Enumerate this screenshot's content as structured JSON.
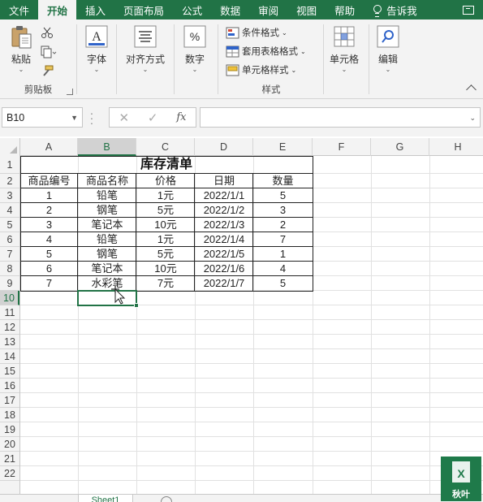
{
  "ribbon_tabs": [
    {
      "label": "文件"
    },
    {
      "label": "开始"
    },
    {
      "label": "插入"
    },
    {
      "label": "页面布局"
    },
    {
      "label": "公式"
    },
    {
      "label": "数据"
    },
    {
      "label": "审阅"
    },
    {
      "label": "视图"
    },
    {
      "label": "帮助"
    },
    {
      "label": "告诉我"
    }
  ],
  "active_tab": "开始",
  "clipboard": {
    "paste_label": "粘贴",
    "group_label": "剪贴板"
  },
  "font": {
    "label": "字体"
  },
  "alignment": {
    "label": "对齐方式"
  },
  "number": {
    "label": "数字"
  },
  "styles": {
    "conditional_format": "条件格式",
    "table_format": "套用表格格式",
    "cell_styles": "单元格样式",
    "group_label": "样式"
  },
  "cells_group": {
    "label": "单元格"
  },
  "editing": {
    "label": "编辑"
  },
  "formula_bar": {
    "name_box": "B10",
    "cancel": "✕",
    "enter": "✓",
    "fx": "fx",
    "formula": ""
  },
  "columns": [
    "A",
    "B",
    "C",
    "D",
    "E",
    "F",
    "G",
    "H"
  ],
  "selected_column": "B",
  "rows": [
    "1",
    "2",
    "3",
    "4",
    "5",
    "6",
    "7",
    "8",
    "9",
    "10",
    "11",
    "12",
    "13",
    "14",
    "15",
    "16",
    "17",
    "18",
    "19",
    "20",
    "21",
    "22"
  ],
  "selected_row": "10",
  "sheet": {
    "title": "库存清单",
    "headers": [
      "商品编号",
      "商品名称",
      "价格",
      "日期",
      "数量"
    ],
    "records": [
      [
        "1",
        "铅笔",
        "1元",
        "2022/1/1",
        "5"
      ],
      [
        "2",
        "钢笔",
        "5元",
        "2022/1/2",
        "3"
      ],
      [
        "3",
        "笔记本",
        "10元",
        "2022/1/3",
        "2"
      ],
      [
        "4",
        "铅笔",
        "1元",
        "2022/1/4",
        "7"
      ],
      [
        "5",
        "钢笔",
        "5元",
        "2022/1/5",
        "1"
      ],
      [
        "6",
        "笔记本",
        "10元",
        "2022/1/6",
        "4"
      ],
      [
        "7",
        "水彩笔",
        "7元",
        "2022/1/7",
        "5"
      ]
    ]
  },
  "sheet_tabs": [
    {
      "label": "Sheet1"
    }
  ],
  "watermark": {
    "label": "秋叶"
  },
  "colors": {
    "accent": "#217346",
    "ribbon_bg": "#f3f3f3"
  }
}
